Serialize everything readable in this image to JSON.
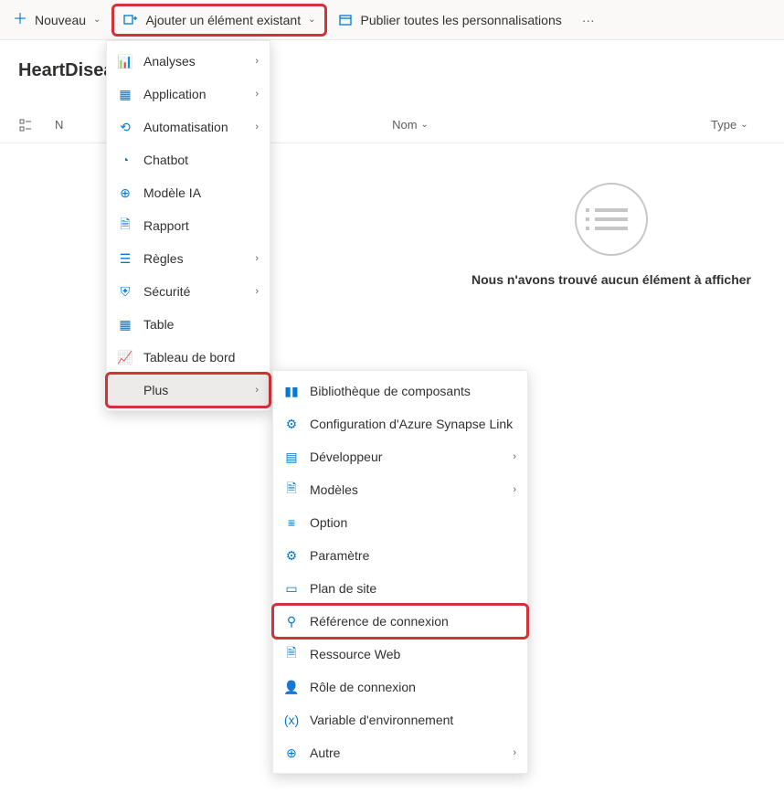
{
  "toolbar": {
    "new": "Nouveau",
    "addExisting": "Ajouter un élément existant",
    "publishAll": "Publier toutes les personnalisations",
    "more": "···"
  },
  "pageTitle": "HeartDisease",
  "columns": {
    "name": "N",
    "nom": "Nom",
    "type": "Type"
  },
  "empty": {
    "message": "Nous n'avons trouvé aucun élément à afficher"
  },
  "menu1": [
    {
      "label": "Analyses",
      "icon": "📊",
      "sub": true
    },
    {
      "label": "Application",
      "icon": "▦",
      "sub": true
    },
    {
      "label": "Automatisation",
      "icon": "⟲",
      "sub": true
    },
    {
      "label": "Chatbot",
      "icon": "◔"
    },
    {
      "label": "Modèle IA",
      "icon": "⊕"
    },
    {
      "label": "Rapport",
      "icon": "🗎"
    },
    {
      "label": "Règles",
      "icon": "☰",
      "sub": true
    },
    {
      "label": "Sécurité",
      "icon": "⛨",
      "sub": true
    },
    {
      "label": "Table",
      "icon": "▦"
    },
    {
      "label": "Tableau de bord",
      "icon": "📈"
    },
    {
      "label": "Plus",
      "icon": "",
      "sub": true,
      "active": true,
      "highlight": true
    }
  ],
  "menu2": [
    {
      "label": "Bibliothèque de composants",
      "icon": "▮▮"
    },
    {
      "label": "Configuration d'Azure Synapse Link",
      "icon": "⚙"
    },
    {
      "label": "Développeur",
      "icon": "▤",
      "sub": true
    },
    {
      "label": "Modèles",
      "icon": "🗎",
      "sub": true
    },
    {
      "label": "Option",
      "icon": "≡"
    },
    {
      "label": "Paramètre",
      "icon": "⚙"
    },
    {
      "label": "Plan de site",
      "icon": "▭"
    },
    {
      "label": "Référence de connexion",
      "icon": "⚲",
      "highlight": true
    },
    {
      "label": "Ressource Web",
      "icon": "🗎"
    },
    {
      "label": "Rôle de connexion",
      "icon": "👤"
    },
    {
      "label": "Variable d'environnement",
      "icon": "(x)"
    },
    {
      "label": "Autre",
      "icon": "⊕",
      "sub": true
    }
  ]
}
